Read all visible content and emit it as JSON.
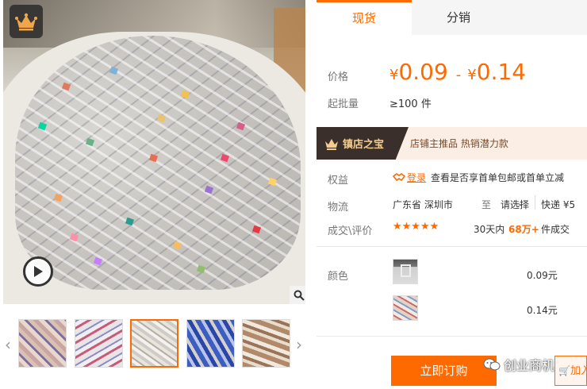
{
  "tabs": {
    "spot": "现货",
    "distribution": "分销"
  },
  "price": {
    "label": "价格",
    "currency": "¥",
    "low": "0.09",
    "separator": "-",
    "high": "0.14"
  },
  "moq": {
    "label": "起批量",
    "value": "≥100 件"
  },
  "gold_store": {
    "badge_text": "镇店之宝",
    "tags": "店铺主推品   热销潜力款"
  },
  "rights": {
    "label": "权益",
    "login_link": "登录",
    "text": "查看是否享首单包邮或首单立减"
  },
  "logistics": {
    "label": "物流",
    "from": "广东省 深圳市",
    "to_label": "至",
    "select": "请选择",
    "fee": "快递 ¥5"
  },
  "reviews": {
    "label": "成交\\评价",
    "rating_stars": 4.5,
    "stars_text": "★★★★★",
    "sales_prefix": "30天内",
    "sales_count": "68万+",
    "sales_suffix": "件成交"
  },
  "sku": {
    "label": "颜色",
    "options": [
      {
        "price": "0.09元"
      },
      {
        "price": "0.14元"
      }
    ]
  },
  "actions": {
    "buy_now": "立即订购",
    "add_to_cart": "加入"
  },
  "watermark": {
    "text": "创业商机"
  },
  "gallery": {
    "thumbnail_count": 5,
    "active_thumbnail": 3
  },
  "colors": {
    "accent": "#ff6a00",
    "gold_badge_bg": "#3a2f2a",
    "gold_text": "#f4cc8e"
  }
}
